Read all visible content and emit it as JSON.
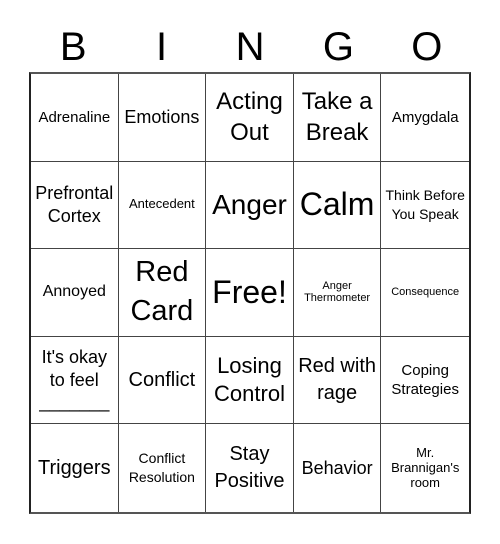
{
  "header": {
    "letters": [
      "B",
      "I",
      "N",
      "G",
      "O"
    ]
  },
  "cells": [
    "Adrenaline",
    "Emotions",
    "Acting Out",
    "Take a Break",
    "Amygdala",
    "Prefrontal Cortex",
    "Antecedent",
    "Anger",
    "Calm",
    "Think Before You Speak",
    "Annoyed",
    "Red Card",
    "Free!",
    "Anger Thermometer",
    "Consequence",
    "It's okay to feel _______",
    "Conflict",
    "Losing Control",
    "Red with rage",
    "Coping Strategies",
    "Triggers",
    "Conflict Resolution",
    "Stay Positive",
    "Behavior",
    "Mr. Brannigan's room"
  ]
}
